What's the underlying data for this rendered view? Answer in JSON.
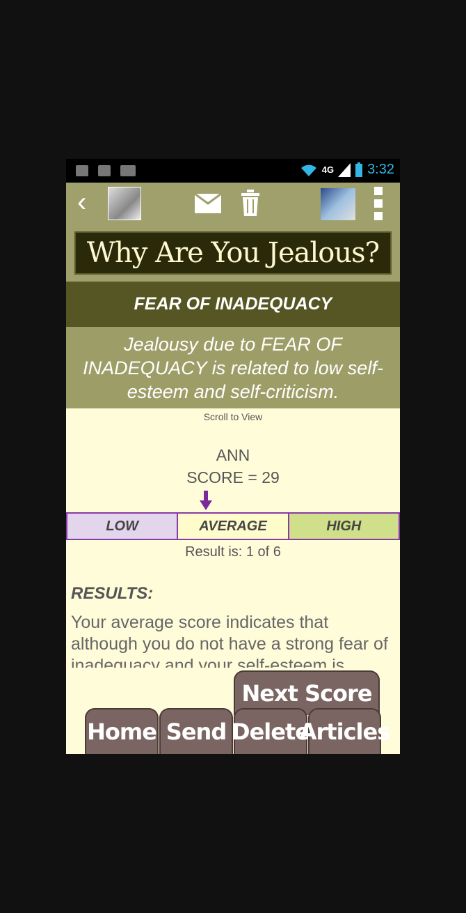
{
  "status_bar": {
    "network": "4G",
    "time": "3:32",
    "icons": [
      "bug-icon",
      "usb-icon",
      "signal-icon",
      "wifi-icon",
      "battery-icon"
    ]
  },
  "action_bar": {
    "icons": [
      "back-chevron-icon",
      "avatar",
      "mail-icon",
      "trash-icon",
      "app-logo-icon",
      "overflow-menu-icon"
    ]
  },
  "title": "Why Are You Jealous?",
  "heading": "FEAR OF INADEQUACY",
  "description": "Jealousy due to FEAR OF INADEQUACY is related to low self-esteem and self-criticism.",
  "scroll_hint": "Scroll to View",
  "person": {
    "name": "ANN",
    "score": "SCORE = 29"
  },
  "scale": {
    "low": "LOW",
    "average": "AVERAGE",
    "high": "HIGH",
    "marker_segment": "AVERAGE",
    "colors": {
      "border": "#8a3aa8",
      "low": "#e3d5ec",
      "average": "#fffccc",
      "high": "#d0e08a",
      "arrow": "#7a2a9a"
    }
  },
  "result_line": "Result is: 1 of 6",
  "results": {
    "label": "RESULTS:",
    "body": "Your average score indicates that although you do not have a strong fear of inadequacy and your self-esteem is"
  },
  "buttons": {
    "next_score": "Next Score",
    "home": "Home",
    "send": "Send",
    "delete": "Delete",
    "articles": "Articles"
  },
  "colors": {
    "background": "#fffcda",
    "action_bar": "#a0a06c",
    "heading_band": "#565624",
    "button": "#7a6562"
  }
}
